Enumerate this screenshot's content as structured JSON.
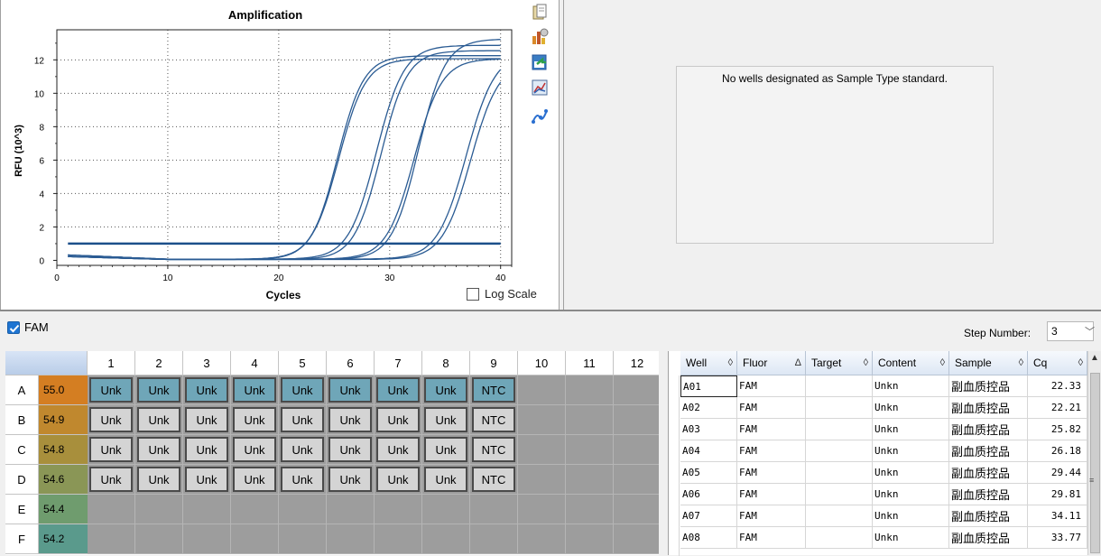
{
  "chart_data": {
    "type": "line",
    "title": "Amplification",
    "xlabel": "Cycles",
    "ylabel": "RFU (10^3)",
    "xlim": [
      0,
      41
    ],
    "ylim": [
      -0.3,
      13.8
    ],
    "xticks": [
      0,
      10,
      20,
      30,
      40
    ],
    "yticks": [
      0,
      2,
      4,
      6,
      8,
      10,
      12
    ],
    "grid": "dotted",
    "threshold": 1.0,
    "series": [
      {
        "plateau": 12.0,
        "midpoint": 25.4,
        "slope": 1.22,
        "color": "#2a5b93"
      },
      {
        "plateau": 12.2,
        "midpoint": 25.3,
        "slope": 1.18,
        "color": "#2a5b93"
      },
      {
        "plateau": 12.8,
        "midpoint": 28.8,
        "slope": 1.25,
        "color": "#2a5b93"
      },
      {
        "plateau": 12.5,
        "midpoint": 29.2,
        "slope": 1.2,
        "color": "#2a5b93"
      },
      {
        "plateau": 12.0,
        "midpoint": 32.2,
        "slope": 1.25,
        "color": "#2a5b93"
      },
      {
        "plateau": 13.2,
        "midpoint": 32.6,
        "slope": 1.2,
        "color": "#2a5b93"
      },
      {
        "plateau": 12.4,
        "midpoint": 36.9,
        "slope": 1.3,
        "color": "#2a5b93"
      },
      {
        "plateau": 11.9,
        "midpoint": 37.3,
        "slope": 1.28,
        "color": "#2a5b93"
      }
    ]
  },
  "chart_panel": {
    "log_scale_label": "Log Scale",
    "icons": [
      "copy-icon",
      "chart-settings-icon",
      "export-icon",
      "zoom-chart-icon",
      "curve-fit-icon"
    ]
  },
  "standard_panel": {
    "message": "No wells designated as Sample Type standard."
  },
  "fluor_bar": {
    "fam_label": "FAM",
    "step_label": "Step Number:",
    "step_value": "3"
  },
  "plate": {
    "columns": [
      "1",
      "2",
      "3",
      "4",
      "5",
      "6",
      "7",
      "8",
      "9",
      "10",
      "11",
      "12"
    ],
    "rows": [
      {
        "label": "A",
        "temp": "55.0",
        "temp_color": "#d47e22",
        "cells": [
          "Unk",
          "Unk",
          "Unk",
          "Unk",
          "Unk",
          "Unk",
          "Unk",
          "Unk",
          "NTC",
          "",
          "",
          ""
        ],
        "selected": true
      },
      {
        "label": "B",
        "temp": "54.9",
        "temp_color": "#c0882e",
        "cells": [
          "Unk",
          "Unk",
          "Unk",
          "Unk",
          "Unk",
          "Unk",
          "Unk",
          "Unk",
          "NTC",
          "",
          "",
          ""
        ],
        "selected": false
      },
      {
        "label": "C",
        "temp": "54.8",
        "temp_color": "#a88f3c",
        "cells": [
          "Unk",
          "Unk",
          "Unk",
          "Unk",
          "Unk",
          "Unk",
          "Unk",
          "Unk",
          "NTC",
          "",
          "",
          ""
        ],
        "selected": false
      },
      {
        "label": "D",
        "temp": "54.6",
        "temp_color": "#8a9656",
        "cells": [
          "Unk",
          "Unk",
          "Unk",
          "Unk",
          "Unk",
          "Unk",
          "Unk",
          "Unk",
          "NTC",
          "",
          "",
          ""
        ],
        "selected": false
      },
      {
        "label": "E",
        "temp": "54.4",
        "temp_color": "#6f9c6e",
        "cells": [
          "",
          "",
          "",
          "",
          "",
          "",
          "",
          "",
          "",
          "",
          "",
          ""
        ],
        "selected": false
      },
      {
        "label": "F",
        "temp": "54.2",
        "temp_color": "#5a9a8c",
        "cells": [
          "",
          "",
          "",
          "",
          "",
          "",
          "",
          "",
          "",
          "",
          "",
          ""
        ],
        "selected": false
      }
    ]
  },
  "table": {
    "columns": [
      {
        "label": "Well",
        "sort": "◊"
      },
      {
        "label": "Fluor",
        "sort": "Δ"
      },
      {
        "label": "Target",
        "sort": "◊"
      },
      {
        "label": "Content",
        "sort": "◊"
      },
      {
        "label": "Sample",
        "sort": "◊"
      },
      {
        "label": "Cq",
        "sort": "◊"
      }
    ],
    "rows": [
      [
        "A01",
        "FAM",
        "",
        "Unkn",
        "副血质控品",
        "22.33"
      ],
      [
        "A02",
        "FAM",
        "",
        "Unkn",
        "副血质控品",
        "22.21"
      ],
      [
        "A03",
        "FAM",
        "",
        "Unkn",
        "副血质控品",
        "25.82"
      ],
      [
        "A04",
        "FAM",
        "",
        "Unkn",
        "副血质控品",
        "26.18"
      ],
      [
        "A05",
        "FAM",
        "",
        "Unkn",
        "副血质控品",
        "29.44"
      ],
      [
        "A06",
        "FAM",
        "",
        "Unkn",
        "副血质控品",
        "29.81"
      ],
      [
        "A07",
        "FAM",
        "",
        "Unkn",
        "副血质控品",
        "34.11"
      ],
      [
        "A08",
        "FAM",
        "",
        "Unkn",
        "副血质控品",
        "33.77"
      ]
    ]
  },
  "colors": {
    "selected_well": "#6fa6b8",
    "unselected_well": "#d4d4d4",
    "empty_well": "#9d9d9d",
    "curve": "#2a5b93"
  }
}
